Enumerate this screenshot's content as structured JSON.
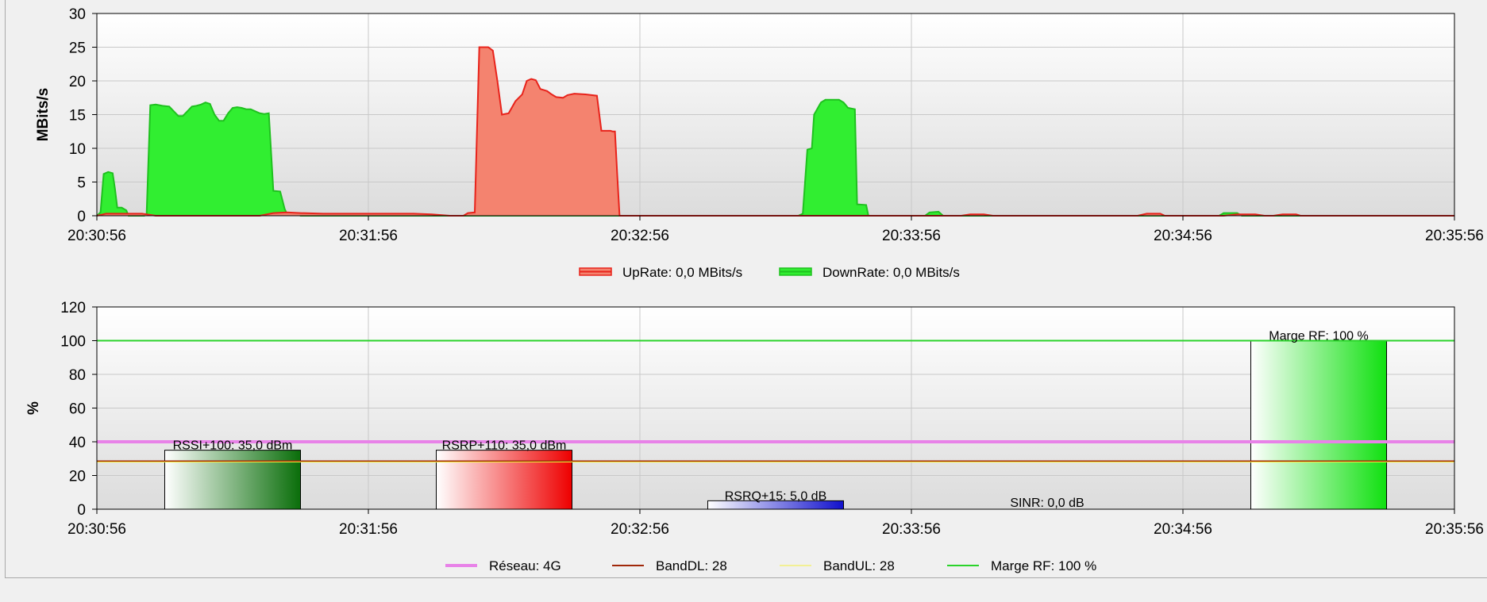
{
  "chart_data": [
    {
      "type": "area",
      "ylabel": "MBits/s",
      "ylim": [
        0,
        30
      ],
      "yticks": [
        "0",
        "5",
        "10",
        "15",
        "20",
        "25",
        "30"
      ],
      "xticks": [
        "20:30:56",
        "20:31:56",
        "20:32:56",
        "20:33:56",
        "20:34:56",
        "20:35:56"
      ],
      "x_unit": "seconds since 20:30:56",
      "xlim": [
        0,
        300
      ],
      "grid": true,
      "legend_position": "bottom",
      "series": [
        {
          "name": "UpRate",
          "legend_label": "UpRate: 0,0 MBits/s",
          "color": "#e8231b",
          "fill": "#f4836f",
          "points": [
            [
              0,
              0
            ],
            [
              2,
              0.3
            ],
            [
              10,
              0.3
            ],
            [
              13,
              0
            ],
            [
              36,
              0
            ],
            [
              39,
              0.4
            ],
            [
              42,
              0.5
            ],
            [
              45,
              0.4
            ],
            [
              50,
              0.3
            ],
            [
              60,
              0.3
            ],
            [
              70,
              0.3
            ],
            [
              74,
              0.2
            ],
            [
              78,
              0
            ],
            [
              81,
              0
            ],
            [
              82,
              0.4
            ],
            [
              83.5,
              0.5
            ],
            [
              84.5,
              25
            ],
            [
              86.5,
              25
            ],
            [
              87.5,
              24.5
            ],
            [
              88.5,
              20
            ],
            [
              89.5,
              15
            ],
            [
              91,
              15.2
            ],
            [
              92.5,
              17
            ],
            [
              94,
              18
            ],
            [
              95,
              20
            ],
            [
              96,
              20.3
            ],
            [
              97,
              20.1
            ],
            [
              98,
              18.8
            ],
            [
              99.5,
              18.5
            ],
            [
              100.5,
              18
            ],
            [
              101.5,
              17.6
            ],
            [
              103,
              17.5
            ],
            [
              104,
              17.9
            ],
            [
              105.5,
              18.1
            ],
            [
              108,
              18
            ],
            [
              110.5,
              17.8
            ],
            [
              111.5,
              12.6
            ],
            [
              113.5,
              12.6
            ],
            [
              114,
              12.5
            ],
            [
              114.5,
              12.5
            ],
            [
              115,
              6
            ],
            [
              115.5,
              0
            ],
            [
              120,
              0
            ],
            [
              180,
              0
            ],
            [
              191,
              0
            ],
            [
              193,
              0.2
            ],
            [
              196,
              0.2
            ],
            [
              198,
              0
            ],
            [
              230,
              0
            ],
            [
              232,
              0.3
            ],
            [
              235,
              0.3
            ],
            [
              236,
              0
            ],
            [
              249,
              0
            ],
            [
              252,
              0.2
            ],
            [
              256,
              0.2
            ],
            [
              258,
              0
            ],
            [
              260,
              0
            ],
            [
              262,
              0.2
            ],
            [
              265,
              0.2
            ],
            [
              266,
              0
            ],
            [
              300,
              0
            ]
          ]
        },
        {
          "name": "DownRate",
          "legend_label": "DownRate: 0,0 MBits/s",
          "color": "#1fc11f",
          "fill": "#31ee31",
          "points": [
            [
              0,
              0
            ],
            [
              0.8,
              0.5
            ],
            [
              1.5,
              6.2
            ],
            [
              2.5,
              6.5
            ],
            [
              3.5,
              6.3
            ],
            [
              4,
              4
            ],
            [
              4.5,
              1.2
            ],
            [
              5.5,
              1.2
            ],
            [
              6.5,
              0.8
            ],
            [
              7,
              0
            ],
            [
              10.5,
              0
            ],
            [
              11,
              0.3
            ],
            [
              11.8,
              16.4
            ],
            [
              13,
              16.5
            ],
            [
              14.5,
              16.3
            ],
            [
              16,
              16.2
            ],
            [
              17,
              15.5
            ],
            [
              18,
              14.8
            ],
            [
              19,
              14.8
            ],
            [
              20,
              15.5
            ],
            [
              21,
              16.2
            ],
            [
              22,
              16.3
            ],
            [
              23,
              16.5
            ],
            [
              24,
              16.8
            ],
            [
              25,
              16.6
            ],
            [
              26,
              15
            ],
            [
              27,
              14.1
            ],
            [
              28,
              14.1
            ],
            [
              29,
              15.2
            ],
            [
              30,
              16
            ],
            [
              31,
              16.1
            ],
            [
              32,
              16
            ],
            [
              33,
              15.8
            ],
            [
              34,
              15.8
            ],
            [
              35,
              15.5
            ],
            [
              36,
              15.2
            ],
            [
              37,
              15.1
            ],
            [
              38,
              15.2
            ],
            [
              39,
              3.7
            ],
            [
              40.5,
              3.6
            ],
            [
              41.5,
              1
            ],
            [
              42,
              0.3
            ],
            [
              44,
              0.3
            ],
            [
              45,
              0
            ],
            [
              100,
              0
            ],
            [
              155,
              0
            ],
            [
              156,
              0.3
            ],
            [
              157,
              9.8
            ],
            [
              158,
              10
            ],
            [
              158.5,
              15
            ],
            [
              160,
              16.8
            ],
            [
              161,
              17.2
            ],
            [
              163,
              17.2
            ],
            [
              164,
              17.2
            ],
            [
              165,
              16.8
            ],
            [
              166,
              16
            ],
            [
              167.5,
              15.8
            ],
            [
              168,
              1.7
            ],
            [
              170,
              1.6
            ],
            [
              170.5,
              0
            ],
            [
              183,
              0
            ],
            [
              184,
              0.5
            ],
            [
              186,
              0.6
            ],
            [
              187,
              0
            ],
            [
              248,
              0
            ],
            [
              249,
              0.4
            ],
            [
              252,
              0.4
            ],
            [
              253,
              0
            ],
            [
              300,
              0
            ]
          ]
        }
      ]
    },
    {
      "type": "bar",
      "ylabel": "%",
      "ylim": [
        0,
        120
      ],
      "yticks": [
        "0",
        "20",
        "40",
        "60",
        "80",
        "100",
        "120"
      ],
      "xticks": [
        "20:30:56",
        "20:31:56",
        "20:32:56",
        "20:33:56",
        "20:34:56",
        "20:35:56"
      ],
      "x_unit": "seconds since 20:30:56",
      "xlim": [
        0,
        300
      ],
      "grid": true,
      "legend_position": "bottom",
      "bars": [
        {
          "label": "RSSI+100: 35,0 dBm",
          "value": 35,
          "x_start": 15,
          "x_end": 45,
          "color": "#0a6e0a"
        },
        {
          "label": "RSRP+110: 35,0 dBm",
          "value": 35,
          "x_start": 75,
          "x_end": 105,
          "color": "#ee0000"
        },
        {
          "label": "RSRQ+15: 5,0 dB",
          "value": 5,
          "x_start": 135,
          "x_end": 165,
          "color": "#1010cc"
        },
        {
          "label": "SINR: 0,0 dB",
          "value": 0,
          "x_start": 195,
          "x_end": 225,
          "color": "#0000ff"
        },
        {
          "label": "Marge RF: 100 %",
          "value": 100,
          "x_start": 255,
          "x_end": 285,
          "color": "#10e010"
        }
      ],
      "lines": [
        {
          "name": "Réseau",
          "legend_label": "Réseau: 4G",
          "value": 40,
          "color": "#e882e8"
        },
        {
          "name": "BandDL",
          "legend_label": "BandDL: 28",
          "value": 28.5,
          "color": "#a0280a"
        },
        {
          "name": "BandUL",
          "legend_label": "BandUL: 28",
          "value": 28,
          "color": "#f4f03a"
        },
        {
          "name": "Marge RF",
          "legend_label": "Marge RF: 100 %",
          "value": 100,
          "color": "#2ad32a"
        }
      ]
    }
  ]
}
